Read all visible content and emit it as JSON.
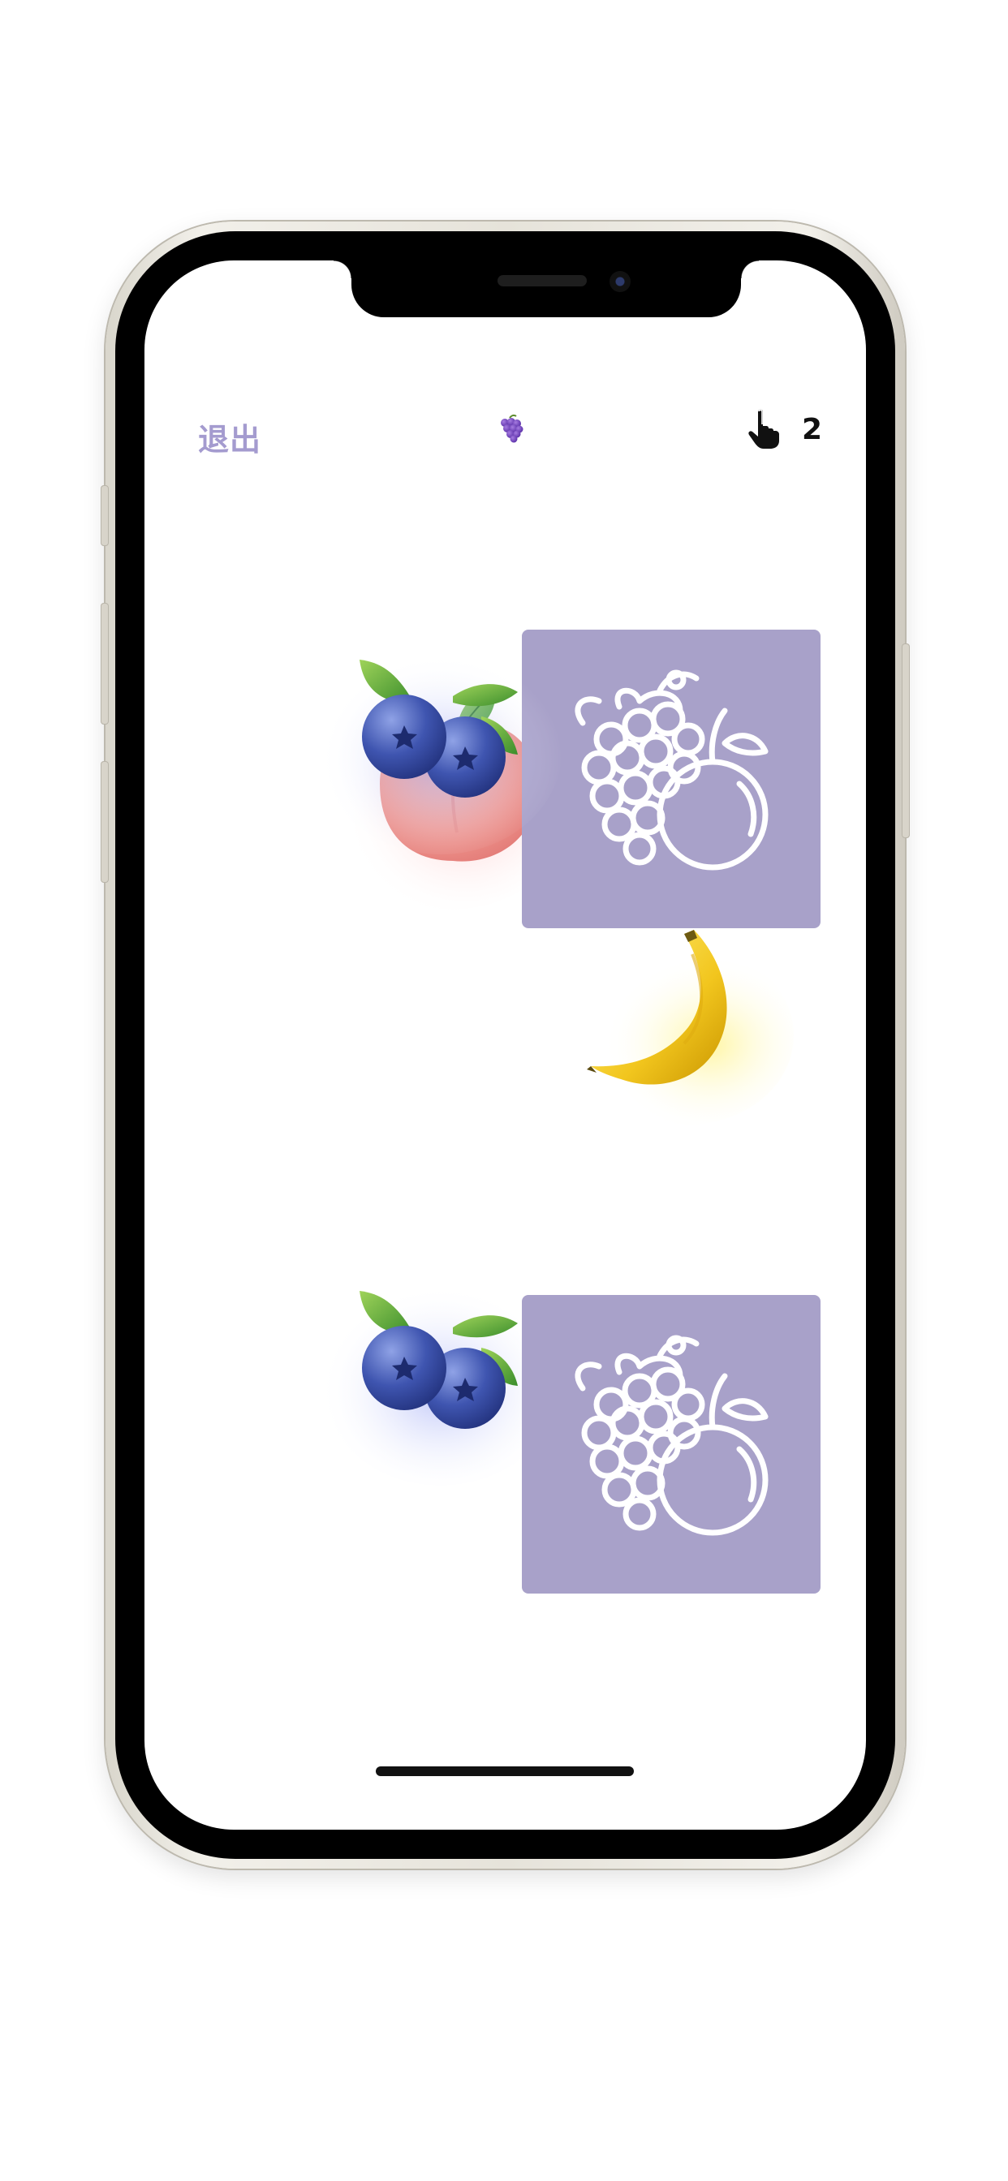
{
  "header": {
    "exit_label": "退出",
    "title_icon": "grapes-icon",
    "taps_icon": "pointing-hand-icon",
    "taps_count": "2"
  },
  "board": {
    "cards": [
      {
        "state": "face-up",
        "fruit": "peach"
      },
      {
        "state": "face-down",
        "fruit": ""
      },
      {
        "state": "face-up",
        "fruit": "blueberries"
      },
      {
        "state": "face-up",
        "fruit": "banana"
      },
      {
        "state": "face-up",
        "fruit": "blueberries"
      },
      {
        "state": "face-down",
        "fruit": ""
      }
    ],
    "card_back_icon": "fruit-outline-icon"
  },
  "colors": {
    "accent": "#a49bcf",
    "card_back": "#a8a1c9"
  }
}
